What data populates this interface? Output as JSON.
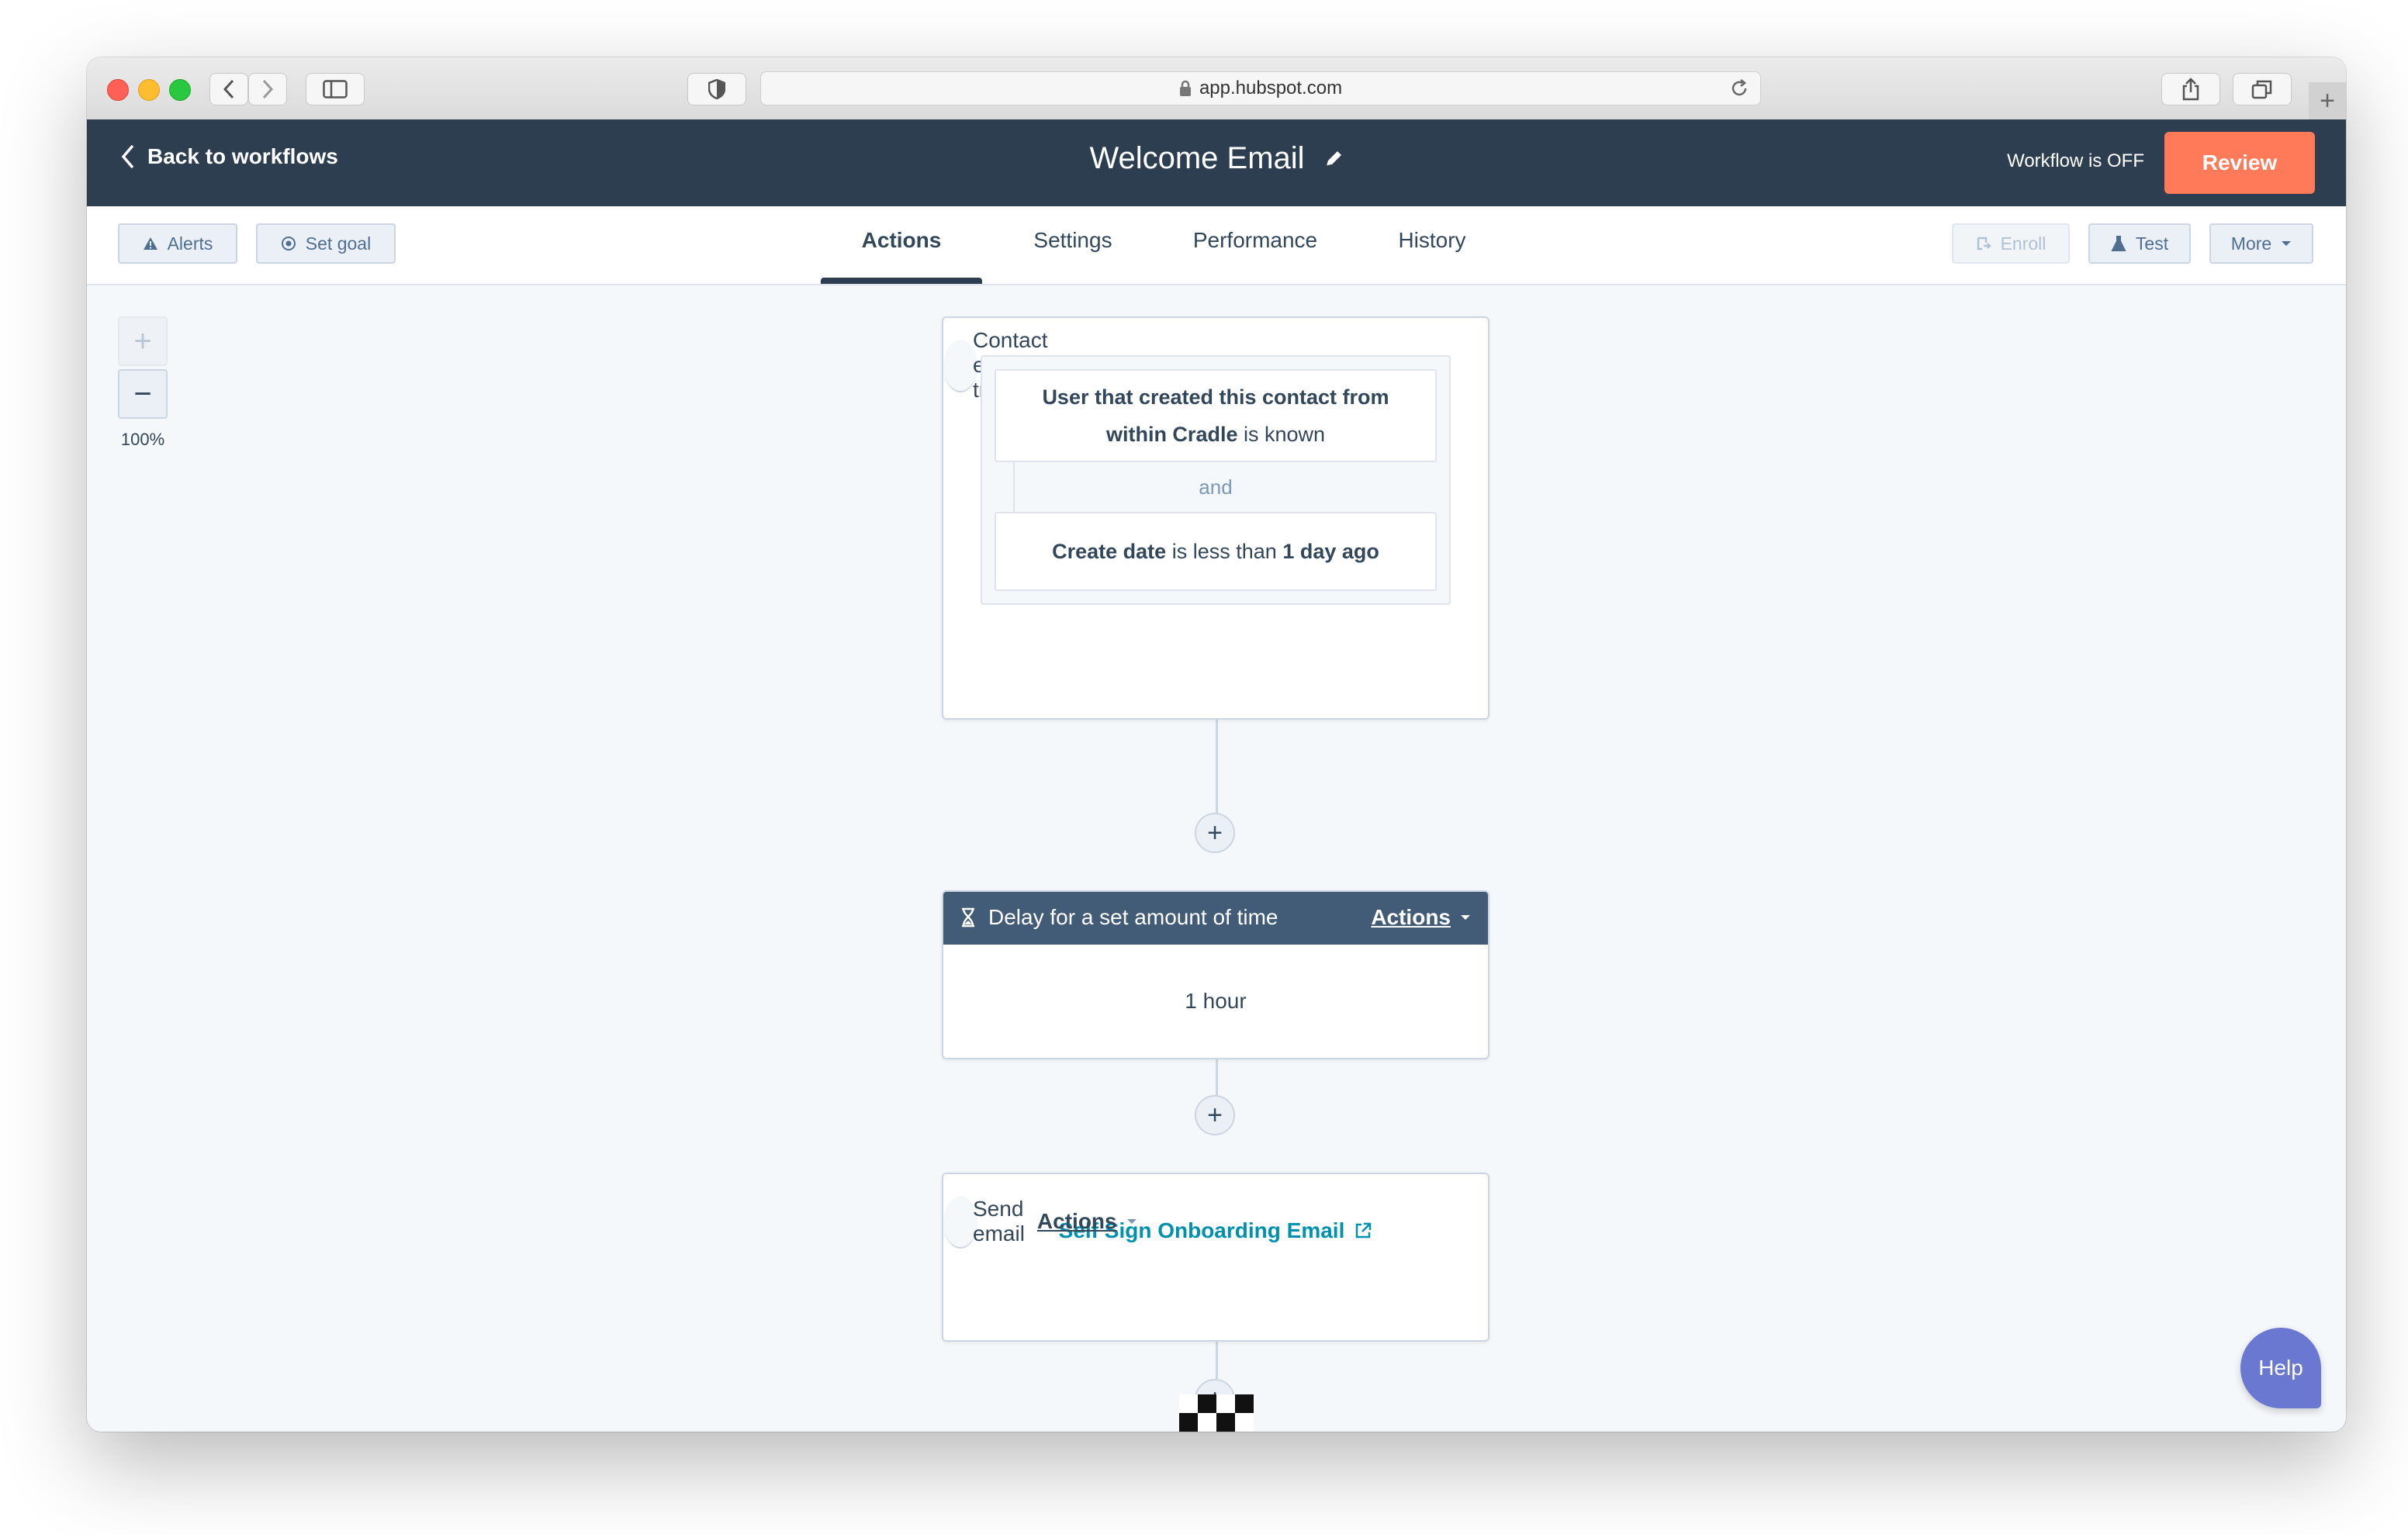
{
  "browser": {
    "url": "app.hubspot.com"
  },
  "header": {
    "back_label": "Back to workflows",
    "title": "Welcome Email",
    "status": "Workflow is OFF",
    "review_label": "Review",
    "review_color": "#ff7a59",
    "bg_color": "#2d3e50"
  },
  "toolbar": {
    "alerts_label": "Alerts",
    "set_goal_label": "Set goal",
    "tabs": [
      {
        "label": "Actions",
        "active": true
      },
      {
        "label": "Settings",
        "active": false
      },
      {
        "label": "Performance",
        "active": false
      },
      {
        "label": "History",
        "active": false
      }
    ],
    "enroll_label": "Enroll",
    "test_label": "Test",
    "more_label": "More"
  },
  "zoom": {
    "in_label": "+",
    "out_label": "−",
    "level": "100%"
  },
  "trigger": {
    "title": "Contact enrollment trigger",
    "filter1": {
      "property": "User that created this contact from within Cradle",
      "operator": "is known"
    },
    "joiner": "and",
    "filter2": {
      "property": "Create date",
      "operator": "is less than",
      "value": "1 day ago"
    }
  },
  "steps": [
    {
      "title": "Delay for a set amount of time",
      "actions_label": "Actions",
      "body": "1 hour",
      "icon": "hourglass-icon"
    },
    {
      "title": "Send email",
      "actions_label": "Actions",
      "body": "Self Sign Onboarding Email",
      "icon": "envelope-icon"
    }
  ],
  "add_action_label": "+",
  "help_label": "Help"
}
